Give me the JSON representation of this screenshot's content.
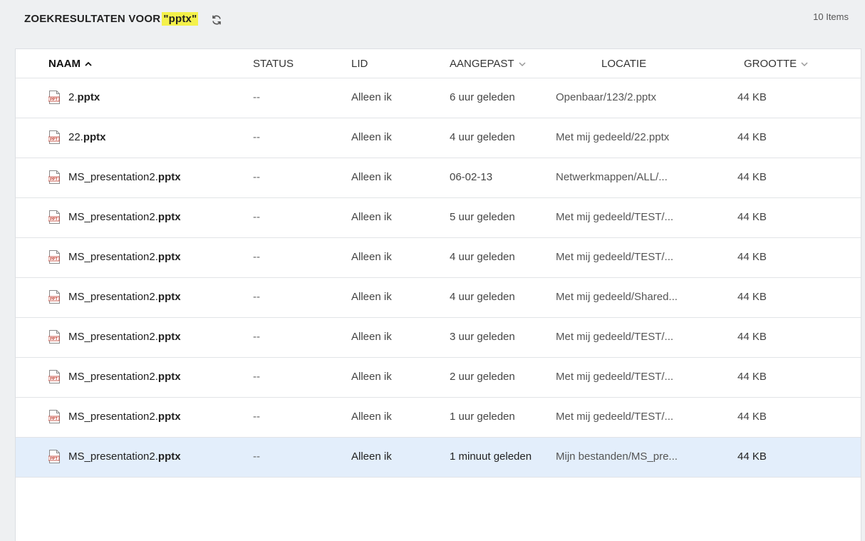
{
  "header": {
    "title_prefix": "ZOEKRESULTATEN VOOR ",
    "query_quoted": "\"pptx\"",
    "count": "10 Items"
  },
  "columns": {
    "naam": "NAAM",
    "status": "STATUS",
    "lid": "LID",
    "aangepast": "AANGEPAST",
    "locatie": "LOCATIE",
    "grootte": "GROOTTE"
  },
  "rows": [
    {
      "name_base": "2.",
      "name_ext": "pptx",
      "status": "--",
      "lid": "Alleen ik",
      "modified": "6 uur geleden",
      "location": "Openbaar/123/2.pptx",
      "size": "44 KB",
      "selected": false
    },
    {
      "name_base": "22.",
      "name_ext": "pptx",
      "status": "--",
      "lid": "Alleen ik",
      "modified": "4 uur geleden",
      "location": "Met mij gedeeld/22.pptx",
      "size": "44 KB",
      "selected": false
    },
    {
      "name_base": "MS_presentation2.",
      "name_ext": "pptx",
      "status": "--",
      "lid": "Alleen ik",
      "modified": "06-02-13",
      "location": "Netwerkmappen/ALL/...",
      "size": "44 KB",
      "selected": false
    },
    {
      "name_base": "MS_presentation2.",
      "name_ext": "pptx",
      "status": "--",
      "lid": "Alleen ik",
      "modified": "5 uur geleden",
      "location": "Met mij gedeeld/TEST/...",
      "size": "44 KB",
      "selected": false
    },
    {
      "name_base": "MS_presentation2.",
      "name_ext": "pptx",
      "status": "--",
      "lid": "Alleen ik",
      "modified": "4 uur geleden",
      "location": "Met mij gedeeld/TEST/...",
      "size": "44 KB",
      "selected": false
    },
    {
      "name_base": "MS_presentation2.",
      "name_ext": "pptx",
      "status": "--",
      "lid": "Alleen ik",
      "modified": "4 uur geleden",
      "location": "Met mij gedeeld/Shared...",
      "size": "44 KB",
      "selected": false
    },
    {
      "name_base": "MS_presentation2.",
      "name_ext": "pptx",
      "status": "--",
      "lid": "Alleen ik",
      "modified": "3 uur geleden",
      "location": "Met mij gedeeld/TEST/...",
      "size": "44 KB",
      "selected": false
    },
    {
      "name_base": "MS_presentation2.",
      "name_ext": "pptx",
      "status": "--",
      "lid": "Alleen ik",
      "modified": "2 uur geleden",
      "location": "Met mij gedeeld/TEST/...",
      "size": "44 KB",
      "selected": false
    },
    {
      "name_base": "MS_presentation2.",
      "name_ext": "pptx",
      "status": "--",
      "lid": "Alleen ik",
      "modified": "1 uur geleden",
      "location": "Met mij gedeeld/TEST/...",
      "size": "44 KB",
      "selected": false
    },
    {
      "name_base": "MS_presentation2.",
      "name_ext": "pptx",
      "status": "--",
      "lid": "Alleen ik",
      "modified": "1 minuut geleden",
      "location": "Mijn bestanden/MS_pre...",
      "size": "44 KB",
      "selected": true
    }
  ],
  "icons": {
    "refresh": "refresh-icon",
    "sort_asc": "chevron-up-icon",
    "sort_desc": "chevron-down-icon",
    "file": "pptx-file-icon",
    "file_label": "PPT"
  },
  "colors": {
    "highlight": "#f4f14a",
    "selected_row": "#e3eefb",
    "file_icon": "#c0392b"
  }
}
